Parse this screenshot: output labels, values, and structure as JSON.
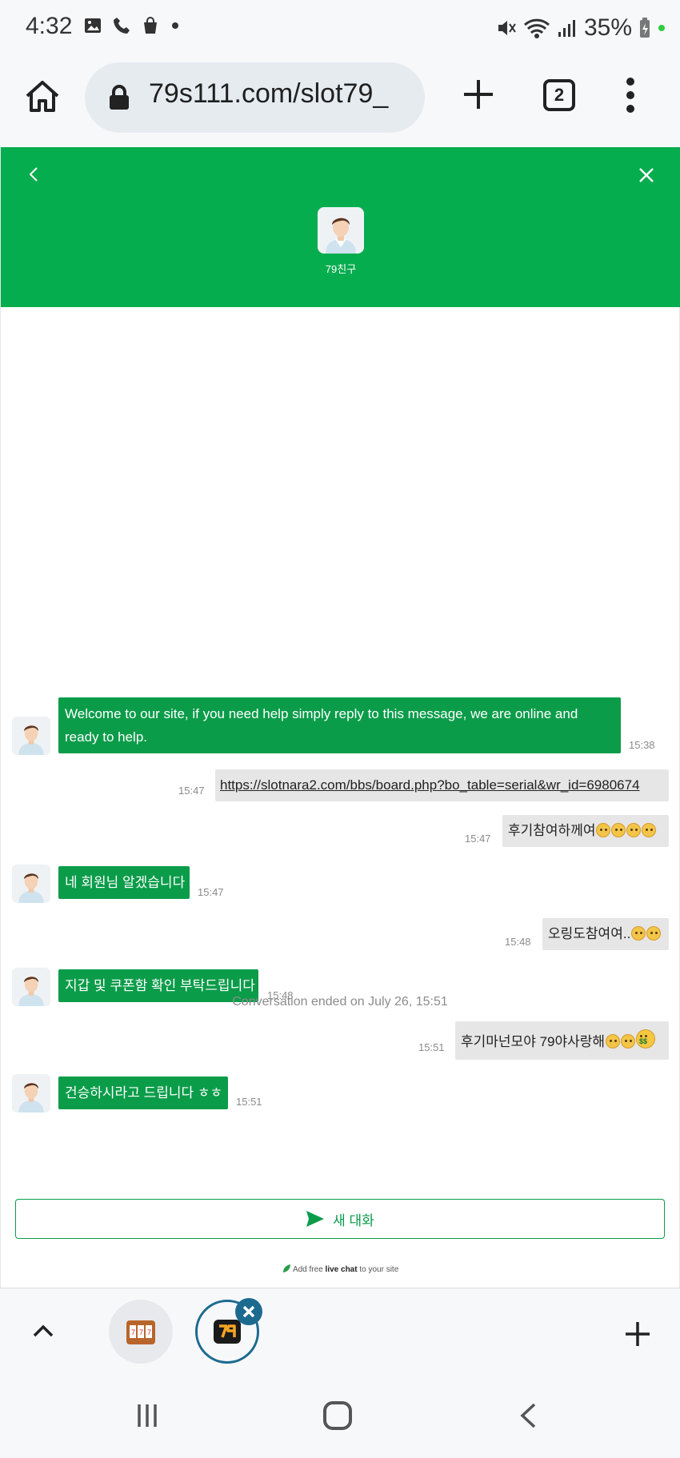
{
  "status_bar": {
    "time": "4:32",
    "battery": "35%"
  },
  "browser": {
    "url": "79s111.com/slot79_",
    "tab_count": "2"
  },
  "chat": {
    "agent_name": "79친구",
    "messages": [
      {
        "from": "agent",
        "text": "Welcome to our site, if you need help simply reply to this message, we are online and ready to help.",
        "time": "15:38"
      },
      {
        "from": "user",
        "text": "https://slotnara2.com/bbs/board.php?bo_table=serial&wr_id=6980674",
        "time": "15:47",
        "is_link": true
      },
      {
        "from": "user",
        "text": "후기참여하께여",
        "time": "15:47",
        "emoji": [
          "pleading-face",
          "pleading-face",
          "pleading-face",
          "pleading-face"
        ]
      },
      {
        "from": "agent",
        "text": "네 회원님 알겠습니다",
        "time": "15:47"
      },
      {
        "from": "user",
        "text": "오링도참여여..",
        "time": "15:48",
        "emoji": [
          "pleading-face",
          "pleading-face"
        ]
      },
      {
        "from": "agent",
        "text": "지갑 및 쿠폰함 확인 부탁드립니다",
        "time": "15:48"
      },
      {
        "from": "user",
        "text": "후기마넌모야 79야사랑해",
        "time": "15:51",
        "emoji": [
          "pleading-face",
          "pleading-face",
          "money-mouth-face"
        ]
      },
      {
        "from": "agent",
        "text": "건승하시라고 드립니다 ㅎㅎ",
        "time": "15:51"
      }
    ],
    "ended_text": "Conversation ended on July 26, 15:51",
    "new_chat_label": "새 대화",
    "powered_prefix": "Add free ",
    "powered_bold": "live chat",
    "powered_suffix": " to your site"
  },
  "colors": {
    "brand_green": "#06ad4f",
    "bubble_agent": "#0b9c4a",
    "bubble_user": "#e6e6e6",
    "tab_ring": "#1d6a90"
  }
}
